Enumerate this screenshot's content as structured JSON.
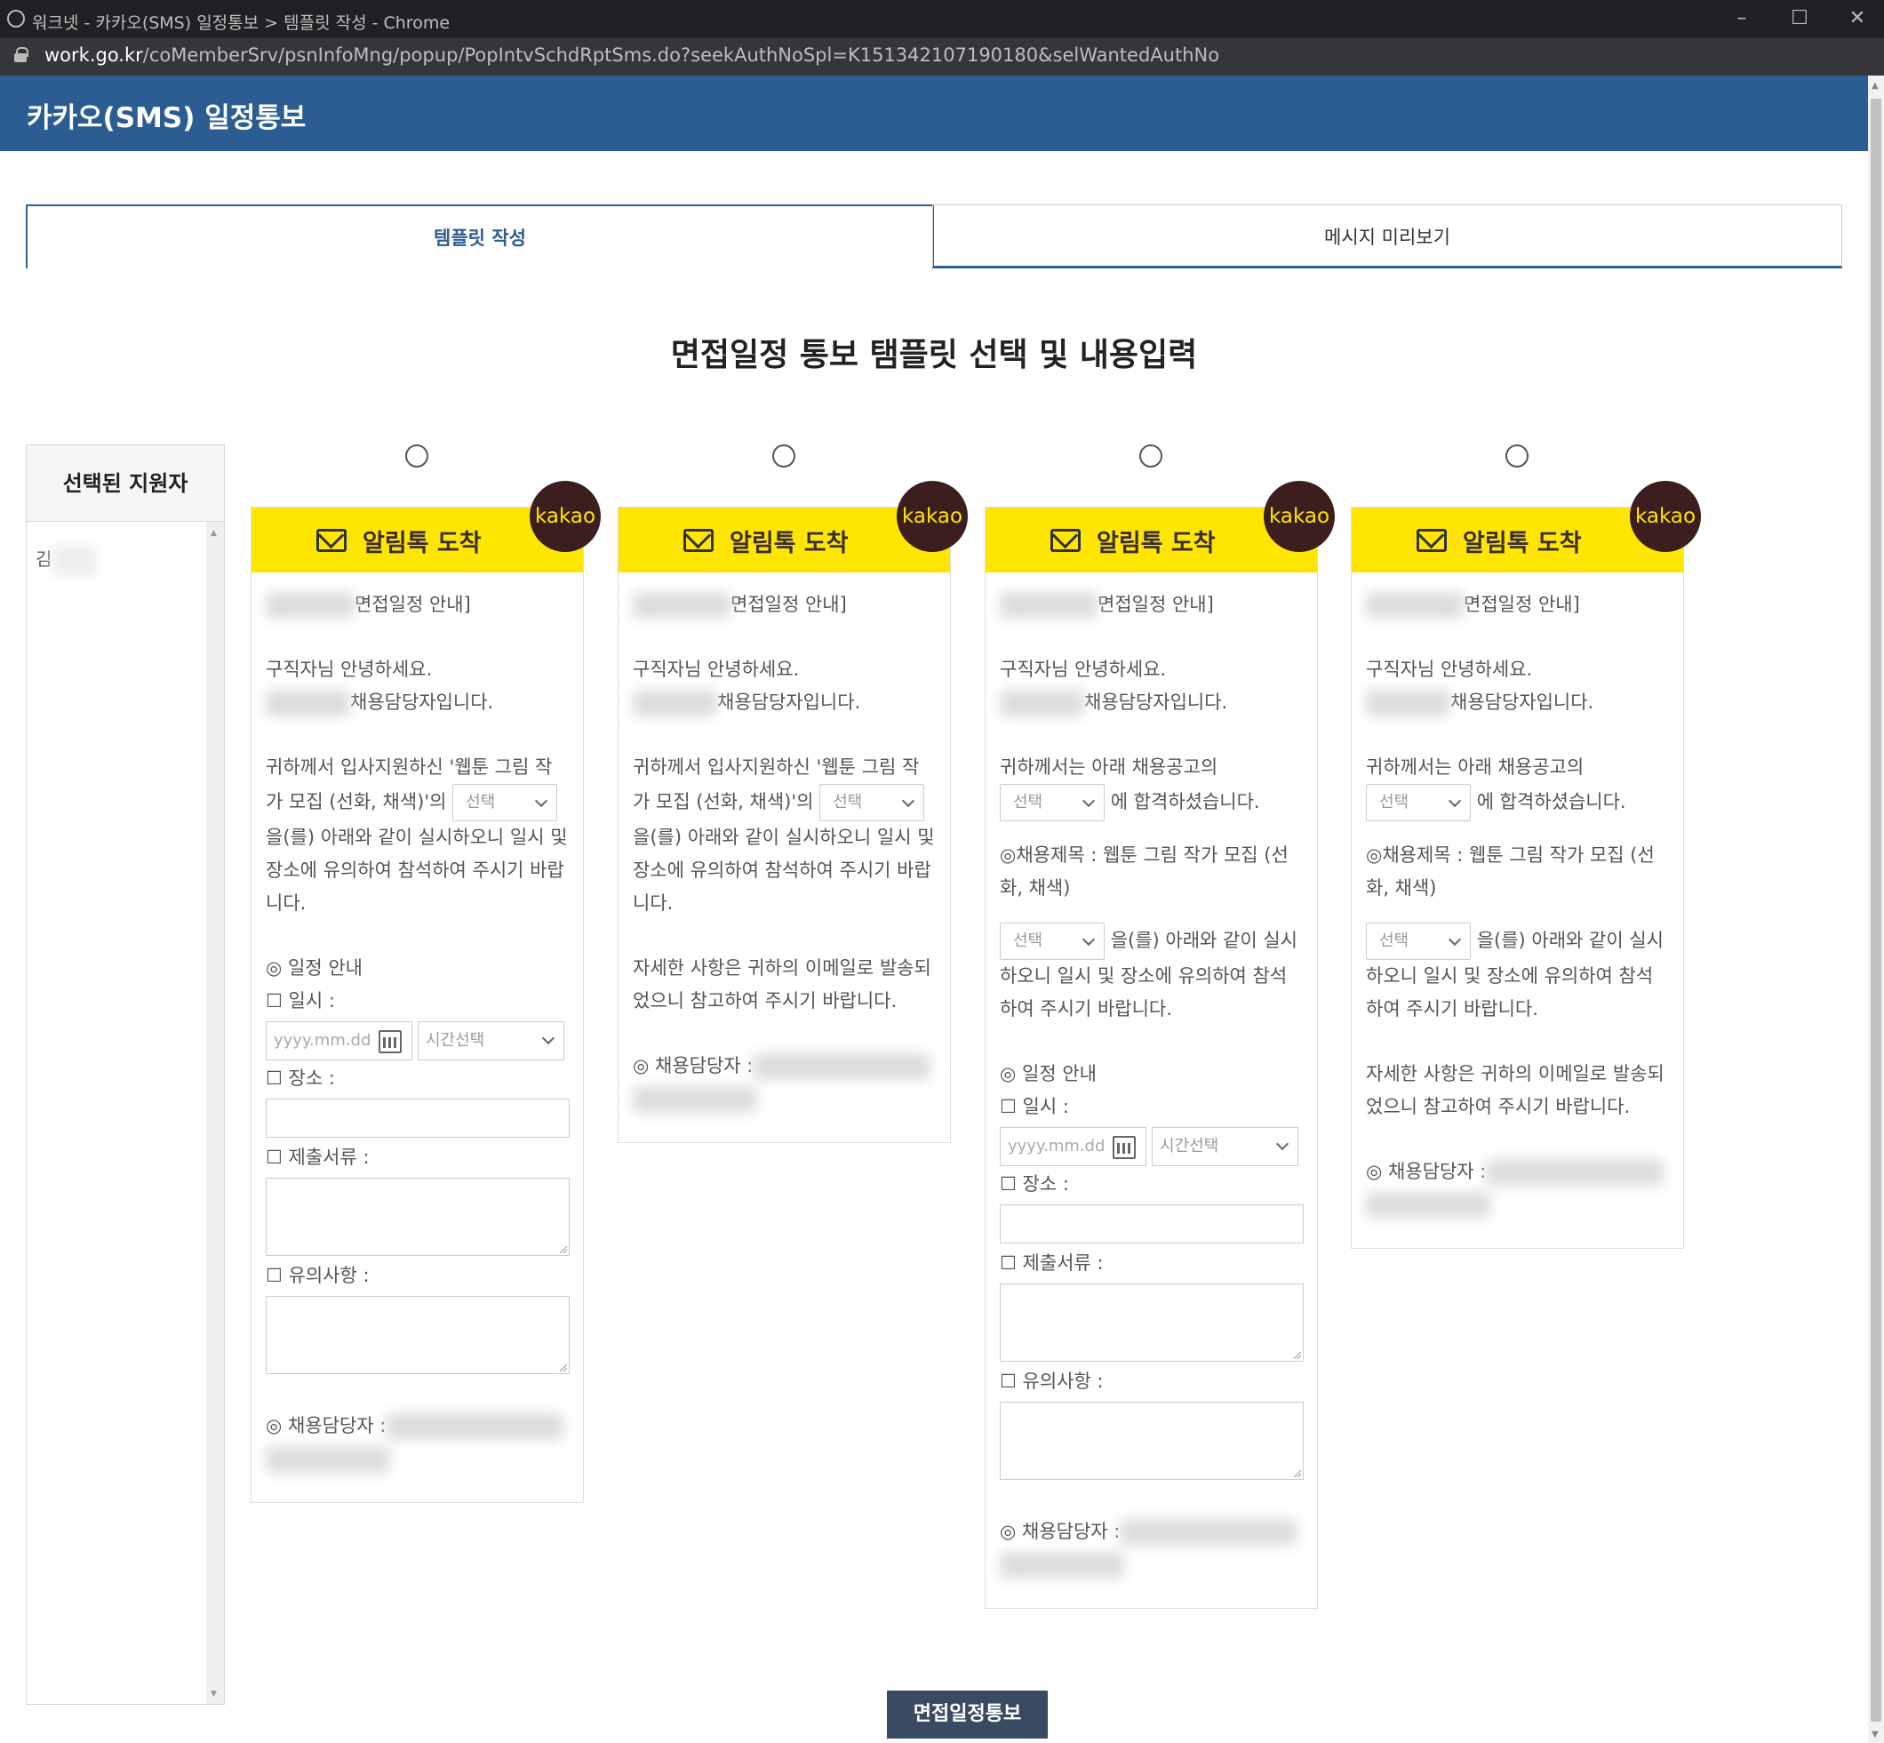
{
  "window": {
    "title": "워크넷 - 카카오(SMS) 일정통보 > 템플릿 작성 - Chrome",
    "url_domain": "work.go.kr",
    "url_path": "/coMemberSrv/psnInfoMng/popup/PopIntvSchdRptSms.do?seekAuthNoSpl=K151342107190180&selWantedAuthNo"
  },
  "header": {
    "title": "카카오(SMS) 일정통보"
  },
  "tabs": [
    {
      "label": "템플릿 작성",
      "active": true
    },
    {
      "label": "메시지 미리보기",
      "active": false
    }
  ],
  "page_title": "면접일정 통보 탬플릿 선택 및 내용입력",
  "applicant_panel": {
    "title": "선택된 지원자",
    "items": [
      "김"
    ]
  },
  "common": {
    "banner_text": "알림톡 도착",
    "kakao_label": "kakao",
    "interview_notice": "면접일정 안내]",
    "greeting": "구직자님 안녕하세요.",
    "recruiter_intro": "채용담당자입니다.",
    "select_placeholder": "선택",
    "date_placeholder": "yyyy.mm.dd",
    "time_placeholder": "시간선택",
    "schedule_heading": "◎ 일정 안내",
    "datetime_label": "☐ 일시 :",
    "place_label": "☐ 장소 :",
    "documents_label": "☐ 제출서류 :",
    "notes_label": "☐ 유의사항 :",
    "contact_label": "◎ 채용담당자 :",
    "detail_email": "자세한 사항은 귀하의 이메일로 발송되었으니 참고하여 주시기 바랍니다.",
    "t1_text_a": "귀하께서 입사지원하신 '웹툰 그림 작가 모집 (선화, 채색)'의",
    "t1_text_b": "을(를) 아래와 같이 실시하오니 일시 및 장소에 유의하여 참석하여 주시기 바랍니다.",
    "t3_text_a": "귀하께서는 아래 채용공고의",
    "t3_text_b": "에 합격하셨습니다.",
    "t3_job_title": "◎채용제목 : 웹툰 그림 작가 모집 (선화, 채색)",
    "t3_text_c": "을(를) 아래와 같이 실시하오니 일시 및 장소에 유의하여 참석하여 주시기 바랍니다."
  },
  "submit_button": "면접일정통보",
  "colors": {
    "header": "#2c5d92",
    "banner": "#ffe600",
    "kakao_badge": "#3c1e1e",
    "submit": "#3b4a63"
  }
}
